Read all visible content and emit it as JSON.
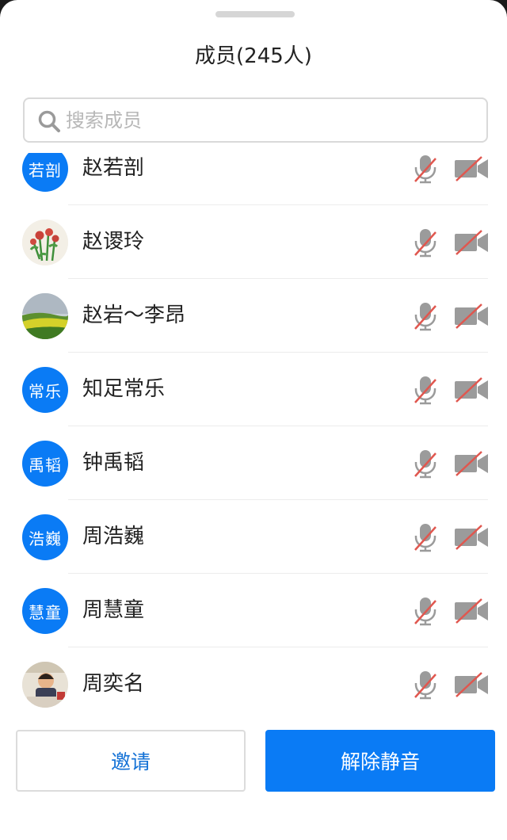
{
  "panel": {
    "title": "成员(245人)"
  },
  "search": {
    "placeholder": "搜索成员",
    "icon": "search-icon"
  },
  "members": [
    {
      "name": "赵若剖",
      "avatar_text": "若剖",
      "avatar_type": "text",
      "mic": "muted",
      "camera": "off"
    },
    {
      "name": "赵谡玲",
      "avatar_text": "",
      "avatar_type": "photo-flowers",
      "mic": "muted",
      "camera": "off"
    },
    {
      "name": "赵岩～李昂",
      "avatar_text": "",
      "avatar_type": "photo-landscape",
      "mic": "muted",
      "camera": "off"
    },
    {
      "name": "知足常乐",
      "avatar_text": "常乐",
      "avatar_type": "text",
      "mic": "muted",
      "camera": "off"
    },
    {
      "name": "钟禹韬",
      "avatar_text": "禹韬",
      "avatar_type": "text",
      "mic": "muted",
      "camera": "off"
    },
    {
      "name": "周浩巍",
      "avatar_text": "浩巍",
      "avatar_type": "text",
      "mic": "muted",
      "camera": "off"
    },
    {
      "name": "周慧童",
      "avatar_text": "慧童",
      "avatar_type": "text",
      "mic": "muted",
      "camera": "off"
    },
    {
      "name": "周奕名",
      "avatar_text": "",
      "avatar_type": "photo-child",
      "mic": "muted",
      "camera": "off"
    }
  ],
  "footer": {
    "invite_label": "邀请",
    "unmute_label": "解除静音"
  },
  "colors": {
    "accent": "#0a7bf5",
    "invite_text": "#1472d6",
    "muted_slash": "#e0574f",
    "icon_gray": "#9b9b9b"
  }
}
